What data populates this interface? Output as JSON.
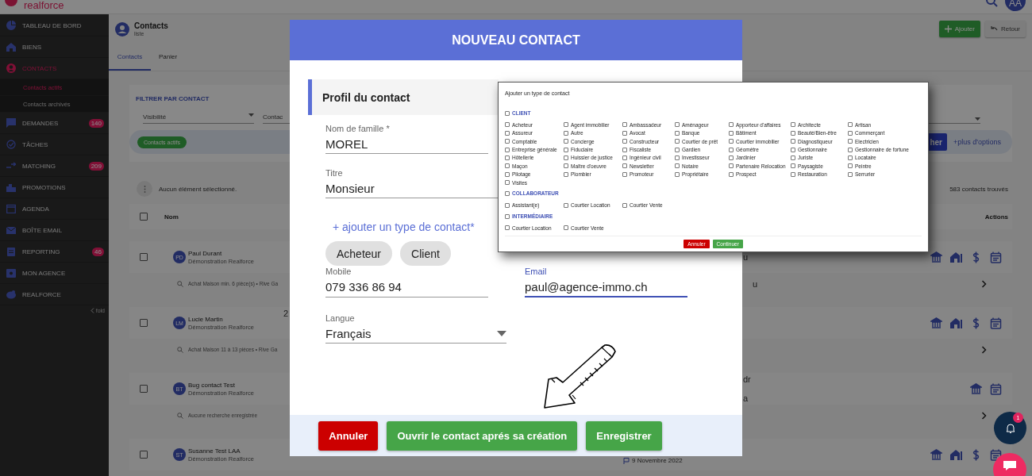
{
  "top_bar": {
    "logo": "realforce",
    "avatar": "AA"
  },
  "sidebar": {
    "items": [
      {
        "label": "TABLEAU DE BORD",
        "selected": false
      },
      {
        "label": "BIENS",
        "selected": false
      },
      {
        "label": "CONTACTS",
        "selected": true,
        "children": [
          {
            "label": "Contacts actifs",
            "selected": true
          },
          {
            "label": "Contacts archivés",
            "selected": false
          }
        ]
      },
      {
        "label": "DEMANDES",
        "selected": false,
        "badge": "140"
      },
      {
        "label": "TÂCHES",
        "selected": false
      },
      {
        "label": "MATCHING",
        "selected": false,
        "badge": "209"
      },
      {
        "label": "PROMOTIONS",
        "selected": false
      },
      {
        "label": "AGENDA",
        "selected": false
      },
      {
        "label": "BOÎTE EMAIL",
        "selected": false
      },
      {
        "label": "REPORTING",
        "selected": false,
        "badge": "46"
      },
      {
        "label": "MON AGENCE",
        "selected": false
      },
      {
        "label": "REALFORCE",
        "selected": false
      }
    ],
    "fold": "fold"
  },
  "page_header": {
    "title": "Contacts",
    "subtitle": "liste",
    "buttons": [
      {
        "label": "Ajouter",
        "kind": "primary"
      },
      {
        "label": "Retour",
        "kind": "secondary"
      }
    ]
  },
  "tabs": [
    {
      "label": "Contacts",
      "selected": true
    },
    {
      "label": "Panier",
      "selected": false
    }
  ],
  "filter": {
    "title": "FILTRER PAR CONTACT",
    "selects": [
      {
        "label": "Visibilité"
      },
      {
        "label": "Contac"
      }
    ],
    "chip": "Contacts actifs",
    "search_button": "her",
    "more_options": "+plus d'options"
  },
  "selection": {
    "text": "Aucun élément sélectionné.",
    "count": "583 contacts trouvés"
  },
  "table": {
    "columns": [
      "Nom",
      "Actions"
    ],
    "all_checked": false,
    "rows": [
      {
        "initials": "PD",
        "name": "Paul Durant",
        "company": "Démonstration Realforce",
        "search": "Achat Maison min. 6 pièce(s) • Rive Ga",
        "left_tail": "",
        "tail": [
          "u"
        ],
        "search_tail": "u",
        "date": "",
        "checked": false,
        "actions": [
          {
            "kind": "bank"
          },
          {
            "kind": "home"
          },
          {
            "kind": "dollar"
          },
          {
            "kind": "calendar"
          }
        ]
      },
      {
        "initials": "LM",
        "name": "Lucie Martin",
        "company": "Démonstration Realforce",
        "search": "Achat Maison 11 à 13 pièces • Rive Ga",
        "left_tail": "2",
        "tail": [],
        "search_tail": "",
        "date": "",
        "checked": false,
        "actions": [
          {
            "kind": "bank"
          },
          {
            "kind": "home"
          },
          {
            "kind": "dollar"
          },
          {
            "kind": "calendar"
          }
        ]
      },
      {
        "initials": "BT",
        "name": "Bug contact Test",
        "company": "Démonstration Realforce",
        "search": "Aucune recherche enregistrée",
        "left_tail": "",
        "tail": [
          "dr",
          "a"
        ],
        "search_tail": "",
        "date": "",
        "checked": false,
        "actions": [
          {
            "kind": "bank"
          },
          {
            "kind": "calendar"
          }
        ]
      },
      {
        "initials": "ST",
        "name": "Susanne Test LAA",
        "company": "Démonstration Realforce",
        "left_tail": "",
        "tail": [],
        "search_tail": "",
        "date": "9 Novembre 2022",
        "checked": false,
        "actions": [
          {
            "kind": "bank"
          },
          {
            "kind": "home"
          },
          {
            "kind": "dollar"
          },
          {
            "kind": "calendar"
          }
        ]
      }
    ]
  },
  "modal": {
    "title": "NOUVEAU CONTACT",
    "section": "Profil du contact",
    "fields_top": [
      {
        "label": "Nom de famille *",
        "value": "MOREL",
        "kind": "text",
        "focused": false
      },
      {
        "label": "Titre",
        "value": "Monsieur",
        "kind": "select",
        "focused": false
      }
    ],
    "add_type": "+ ajouter un type de contact*",
    "types": [
      "Acheteur",
      "Client"
    ],
    "fields_pair": [
      {
        "label": "Mobile",
        "value": "079 336 86 94",
        "kind": "text",
        "focused": false
      },
      {
        "label": "Email",
        "value": "paul@agence-immo.ch",
        "kind": "text",
        "focused": true
      }
    ],
    "fields_bottom": [
      {
        "label": "Langue",
        "value": "Français",
        "kind": "select",
        "focused": false
      }
    ],
    "buttons": [
      {
        "label": "Annuler",
        "kind": "danger"
      },
      {
        "label": "Ouvrir le contact aprés sa création",
        "kind": "success"
      },
      {
        "label": "Enregistrer",
        "kind": "success"
      }
    ]
  },
  "type_dialog": {
    "title": "Ajouter un type de contact",
    "groups": [
      {
        "label": "CLIENT",
        "checked": false,
        "options": [
          {
            "label": "Acheteur",
            "checked": false
          },
          {
            "label": "Agent immobilier",
            "checked": false
          },
          {
            "label": "Ambassadeur",
            "checked": false
          },
          {
            "label": "Aménageur",
            "checked": false
          },
          {
            "label": "Apporteur d'affaires",
            "checked": false
          },
          {
            "label": "Architecte",
            "checked": false
          },
          {
            "label": "Artisan",
            "checked": false
          },
          {
            "label": "Assureur",
            "checked": false
          },
          {
            "label": "Autre",
            "checked": false
          },
          {
            "label": "Avocat",
            "checked": false
          },
          {
            "label": "Banque",
            "checked": false
          },
          {
            "label": "Bâtiment",
            "checked": false
          },
          {
            "label": "Beauté/Bien-être",
            "checked": false
          },
          {
            "label": "Commerçant",
            "checked": false
          },
          {
            "label": "Comptable",
            "checked": false
          },
          {
            "label": "Concierge",
            "checked": false
          },
          {
            "label": "Constructeur",
            "checked": false
          },
          {
            "label": "Courtier de prêt",
            "checked": false
          },
          {
            "label": "Courtier immobilier",
            "checked": false
          },
          {
            "label": "Diagnostiqueur",
            "checked": false
          },
          {
            "label": "Electricien",
            "checked": false
          },
          {
            "label": "Entreprise générale",
            "checked": false
          },
          {
            "label": "Fiduciaire",
            "checked": false
          },
          {
            "label": "Fiscaliste",
            "checked": false
          },
          {
            "label": "Gardien",
            "checked": false
          },
          {
            "label": "Géomètre",
            "checked": false
          },
          {
            "label": "Gestionnaire",
            "checked": false
          },
          {
            "label": "Gestionnaire de fortune",
            "checked": false
          },
          {
            "label": "Hôtellerie",
            "checked": false
          },
          {
            "label": "Huissier de justice",
            "checked": false
          },
          {
            "label": "Ingénieur civil",
            "checked": false
          },
          {
            "label": "Investisseur",
            "checked": false
          },
          {
            "label": "Jardinier",
            "checked": false
          },
          {
            "label": "Juriste",
            "checked": false
          },
          {
            "label": "Locataire",
            "checked": false
          },
          {
            "label": "Maçon",
            "checked": false
          },
          {
            "label": "Maître d'oeuvre",
            "checked": false
          },
          {
            "label": "Newsletter",
            "checked": false
          },
          {
            "label": "Notaire",
            "checked": false
          },
          {
            "label": "Partenaire Relocation",
            "checked": false
          },
          {
            "label": "Paysagiste",
            "checked": false
          },
          {
            "label": "Peintre",
            "checked": false
          },
          {
            "label": "Pilotage",
            "checked": false
          },
          {
            "label": "Plombier",
            "checked": false
          },
          {
            "label": "Promoteur",
            "checked": false
          },
          {
            "label": "Propriétaire",
            "checked": false
          },
          {
            "label": "Prospect",
            "checked": false
          },
          {
            "label": "Restauration",
            "checked": false
          },
          {
            "label": "Serrurier",
            "checked": false
          },
          {
            "label": "Visites",
            "checked": false
          }
        ]
      },
      {
        "label": "COLLABORATEUR",
        "checked": false,
        "options": [
          {
            "label": "Assistant(e)",
            "checked": false
          },
          {
            "label": "Courtier Location",
            "checked": false
          },
          {
            "label": "Courtier Vente",
            "checked": false
          }
        ]
      },
      {
        "label": "INTERMÉDIAIRE",
        "checked": false,
        "options": [
          {
            "label": "Courtier Location",
            "checked": false
          },
          {
            "label": "Courtier Vente",
            "checked": false
          }
        ]
      }
    ],
    "buttons": [
      {
        "label": "Annuler",
        "kind": "danger"
      },
      {
        "label": "Continuer",
        "kind": "success"
      }
    ]
  },
  "notifications": {
    "badge": "1"
  }
}
